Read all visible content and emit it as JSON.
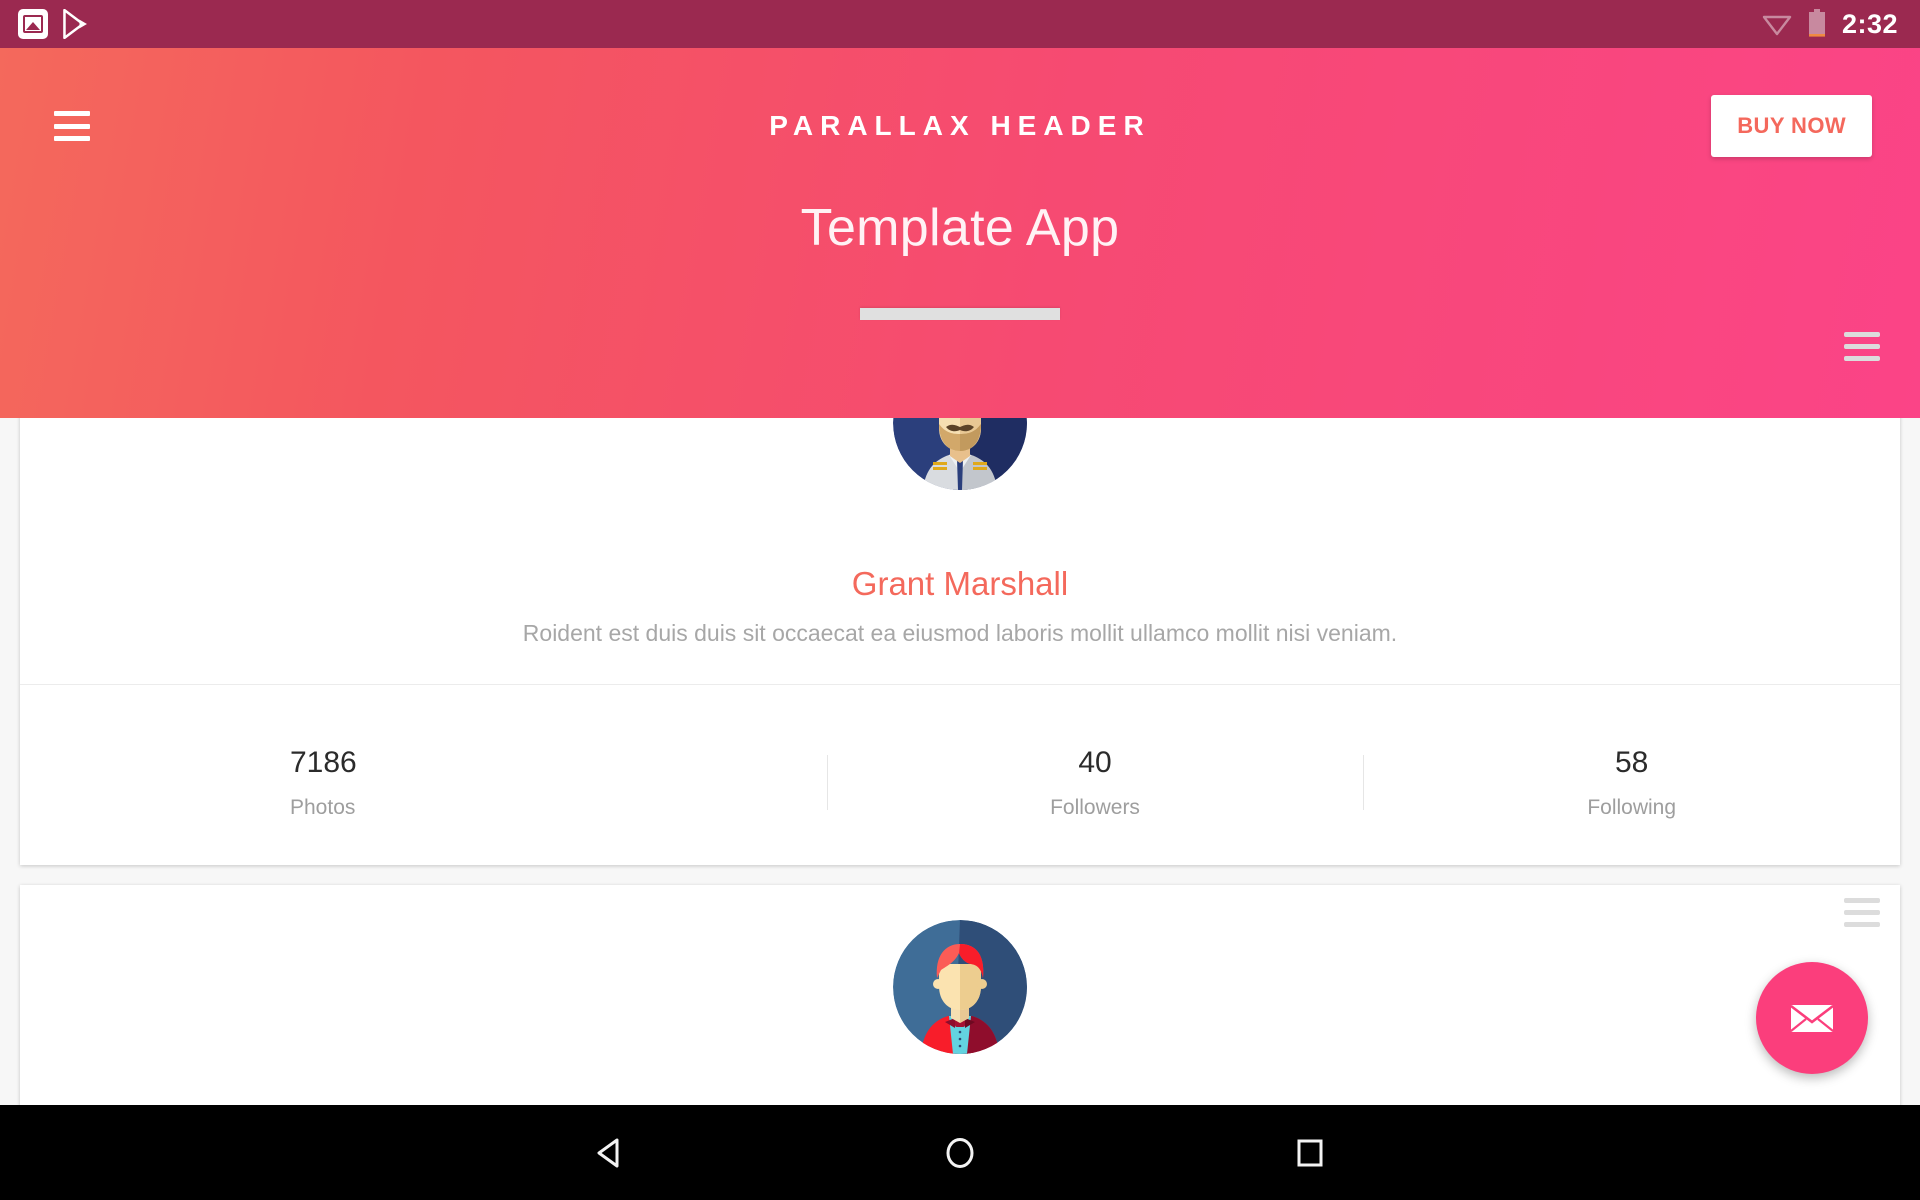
{
  "statusbar": {
    "time": "2:32",
    "left_icons": [
      {
        "name": "screenshot-image-icon",
        "label": "Screenshot"
      },
      {
        "name": "play-store-icon",
        "label": "Play Store"
      }
    ],
    "right_icons": [
      {
        "name": "wifi-icon",
        "label": "Wi-Fi"
      },
      {
        "name": "battery-icon",
        "label": "Battery"
      }
    ]
  },
  "header": {
    "brand": "PARALLAX HEADER",
    "buy_now_label": "BUY NOW",
    "menu_icon": "hamburger-menu-icon",
    "hero_title": "Template App",
    "gradient_start": "#f4695c",
    "gradient_end": "#fb4487",
    "buy_now_text_color": "#f4685c"
  },
  "cards": [
    {
      "menu_icon": "card-menu-icon",
      "avatar_name": "sea-captain-avatar",
      "name": "Grant Marshall",
      "name_color": "#f4695c",
      "description": "Roident est duis duis sit occaecat ea eiusmod laboris mollit ullamco mollit nisi veniam.",
      "stats": [
        {
          "value": "7186",
          "label": "Photos"
        },
        {
          "value": "40",
          "label": "Followers"
        },
        {
          "value": "58",
          "label": "Following"
        }
      ]
    },
    {
      "menu_icon": "card-menu-icon",
      "avatar_name": "red-suit-avatar"
    }
  ],
  "fab": {
    "icon": "envelope-icon",
    "color": "#fb3e7c"
  },
  "androidnav": {
    "back": "back-triangle-icon",
    "home": "home-circle-icon",
    "recents": "recents-square-icon"
  }
}
